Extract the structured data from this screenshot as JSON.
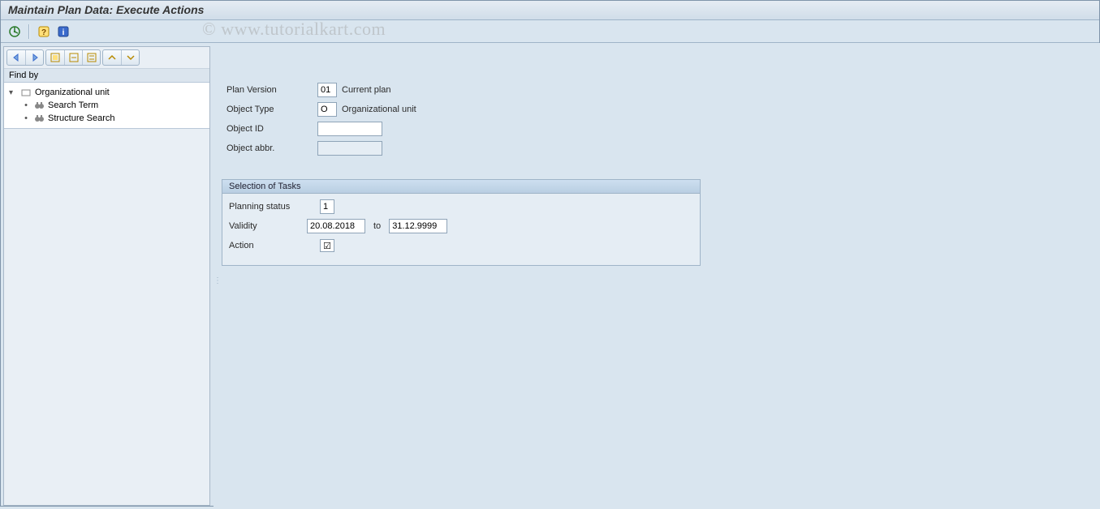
{
  "title": "Maintain Plan Data: Execute Actions",
  "watermark": "© www.tutorialkart.com",
  "sidebar": {
    "findby_label": "Find by",
    "root": {
      "label": "Organizational unit"
    },
    "children": [
      {
        "label": "Search Term"
      },
      {
        "label": "Structure Search"
      }
    ]
  },
  "form": {
    "plan_version": {
      "label": "Plan Version",
      "value": "01",
      "desc": "Current plan"
    },
    "object_type": {
      "label": "Object Type",
      "value": "O",
      "desc": "Organizational unit"
    },
    "object_id": {
      "label": "Object ID",
      "value": ""
    },
    "object_abbr": {
      "label": "Object abbr.",
      "value": ""
    }
  },
  "tasks": {
    "title": "Selection of Tasks",
    "planning_status": {
      "label": "Planning status",
      "value": "1"
    },
    "validity": {
      "label": "Validity",
      "from": "20.08.2018",
      "to_label": "to",
      "to": "31.12.9999"
    },
    "action": {
      "label": "Action",
      "checked_glyph": "☑"
    }
  },
  "icons": {
    "execute": "execute-icon",
    "help": "help-icon",
    "info": "info-icon"
  }
}
